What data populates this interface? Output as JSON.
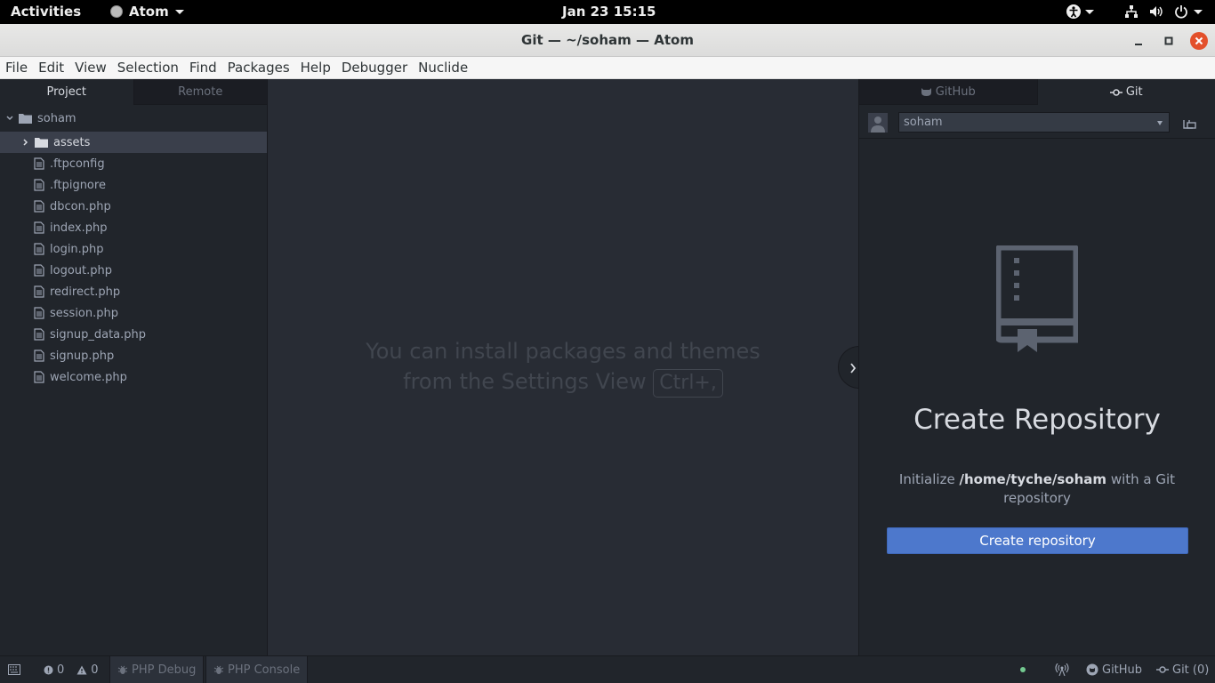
{
  "topbar": {
    "activities": "Activities",
    "app_name": "Atom",
    "clock": "Jan 23  15:15"
  },
  "window": {
    "title": "Git — ~/soham — Atom"
  },
  "menubar": {
    "items": [
      "File",
      "Edit",
      "View",
      "Selection",
      "Find",
      "Packages",
      "Help",
      "Debugger",
      "Nuclide"
    ]
  },
  "tree_panel": {
    "tabs": [
      "Project",
      "Remote"
    ],
    "root": "soham",
    "folder": "assets",
    "files": [
      ".ftpconfig",
      ".ftpignore",
      "dbcon.php",
      "index.php",
      "login.php",
      "logout.php",
      "redirect.php",
      "session.php",
      "signup_data.php",
      "signup.php",
      "welcome.php"
    ]
  },
  "editor": {
    "welcome_line1": "You can install packages and themes",
    "welcome_line2": "from the Settings View",
    "shortcut": "Ctrl+,"
  },
  "git_panel": {
    "tabs": [
      "GitHub",
      "Git"
    ],
    "user": "soham",
    "heading": "Create Repository",
    "init_prefix": "Initialize",
    "init_path": "/home/tyche/soham",
    "init_suffix": "with a Git repository",
    "button": "Create repository"
  },
  "statusbar": {
    "errors": "0",
    "warnings": "0",
    "php_debug": "PHP Debug",
    "php_console": "PHP Console",
    "github": "GitHub",
    "git": "Git (0)"
  },
  "colors": {
    "accent": "#4d78cc",
    "close_button": "#e3502b",
    "status_dot": "#73c990"
  }
}
